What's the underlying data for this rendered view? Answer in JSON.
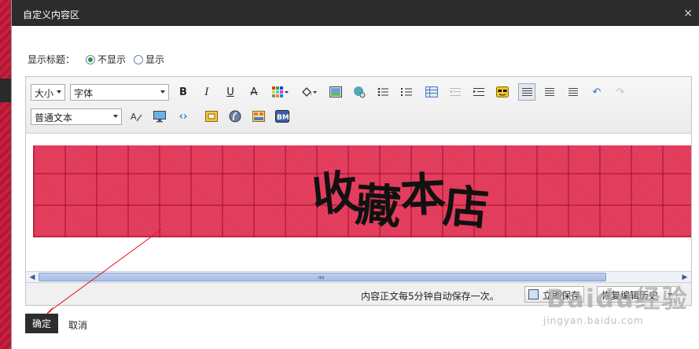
{
  "dialog": {
    "title": "自定义内容区",
    "close_icon": "×"
  },
  "show_title": {
    "label": "显示标题：",
    "options": [
      "不显示",
      "显示"
    ],
    "selected": "不显示"
  },
  "toolbar": {
    "size_select": "大小",
    "font_select": "字体",
    "format_select": "普通文本",
    "bold": "B",
    "italic": "I",
    "underline": "U",
    "strike": "A",
    "bm_label": "BM",
    "icons": [
      "bold-icon",
      "italic-icon",
      "underline-icon",
      "strikethrough-icon",
      "color-grid-icon",
      "fill-color-icon",
      "image-icon",
      "globe-link-icon",
      "bullet-list-icon",
      "numbered-list-icon",
      "table-icon",
      "outdent-icon",
      "indent-icon",
      "emoticon-icon",
      "align-left-icon",
      "align-center-icon",
      "align-right-icon",
      "undo-icon",
      "redo-icon",
      "brush-icon",
      "monitor-icon",
      "code-icon",
      "media-icon",
      "flash-icon",
      "layout-icon",
      "bm-icon"
    ]
  },
  "content": {
    "banner_text": [
      "收",
      "藏",
      "本",
      "店"
    ],
    "banner_color": "#e23a5a"
  },
  "status": {
    "message": "内容正文每5分钟自动保存一次。",
    "save_label": "立即保存",
    "history_label": "恢复编辑历史"
  },
  "footer": {
    "ok_label": "确定",
    "cancel_label": "取消"
  },
  "watermark": {
    "line1": "Baidu经验",
    "line2": "jingyan.baidu.com"
  },
  "annotation_color": "#e0101a"
}
